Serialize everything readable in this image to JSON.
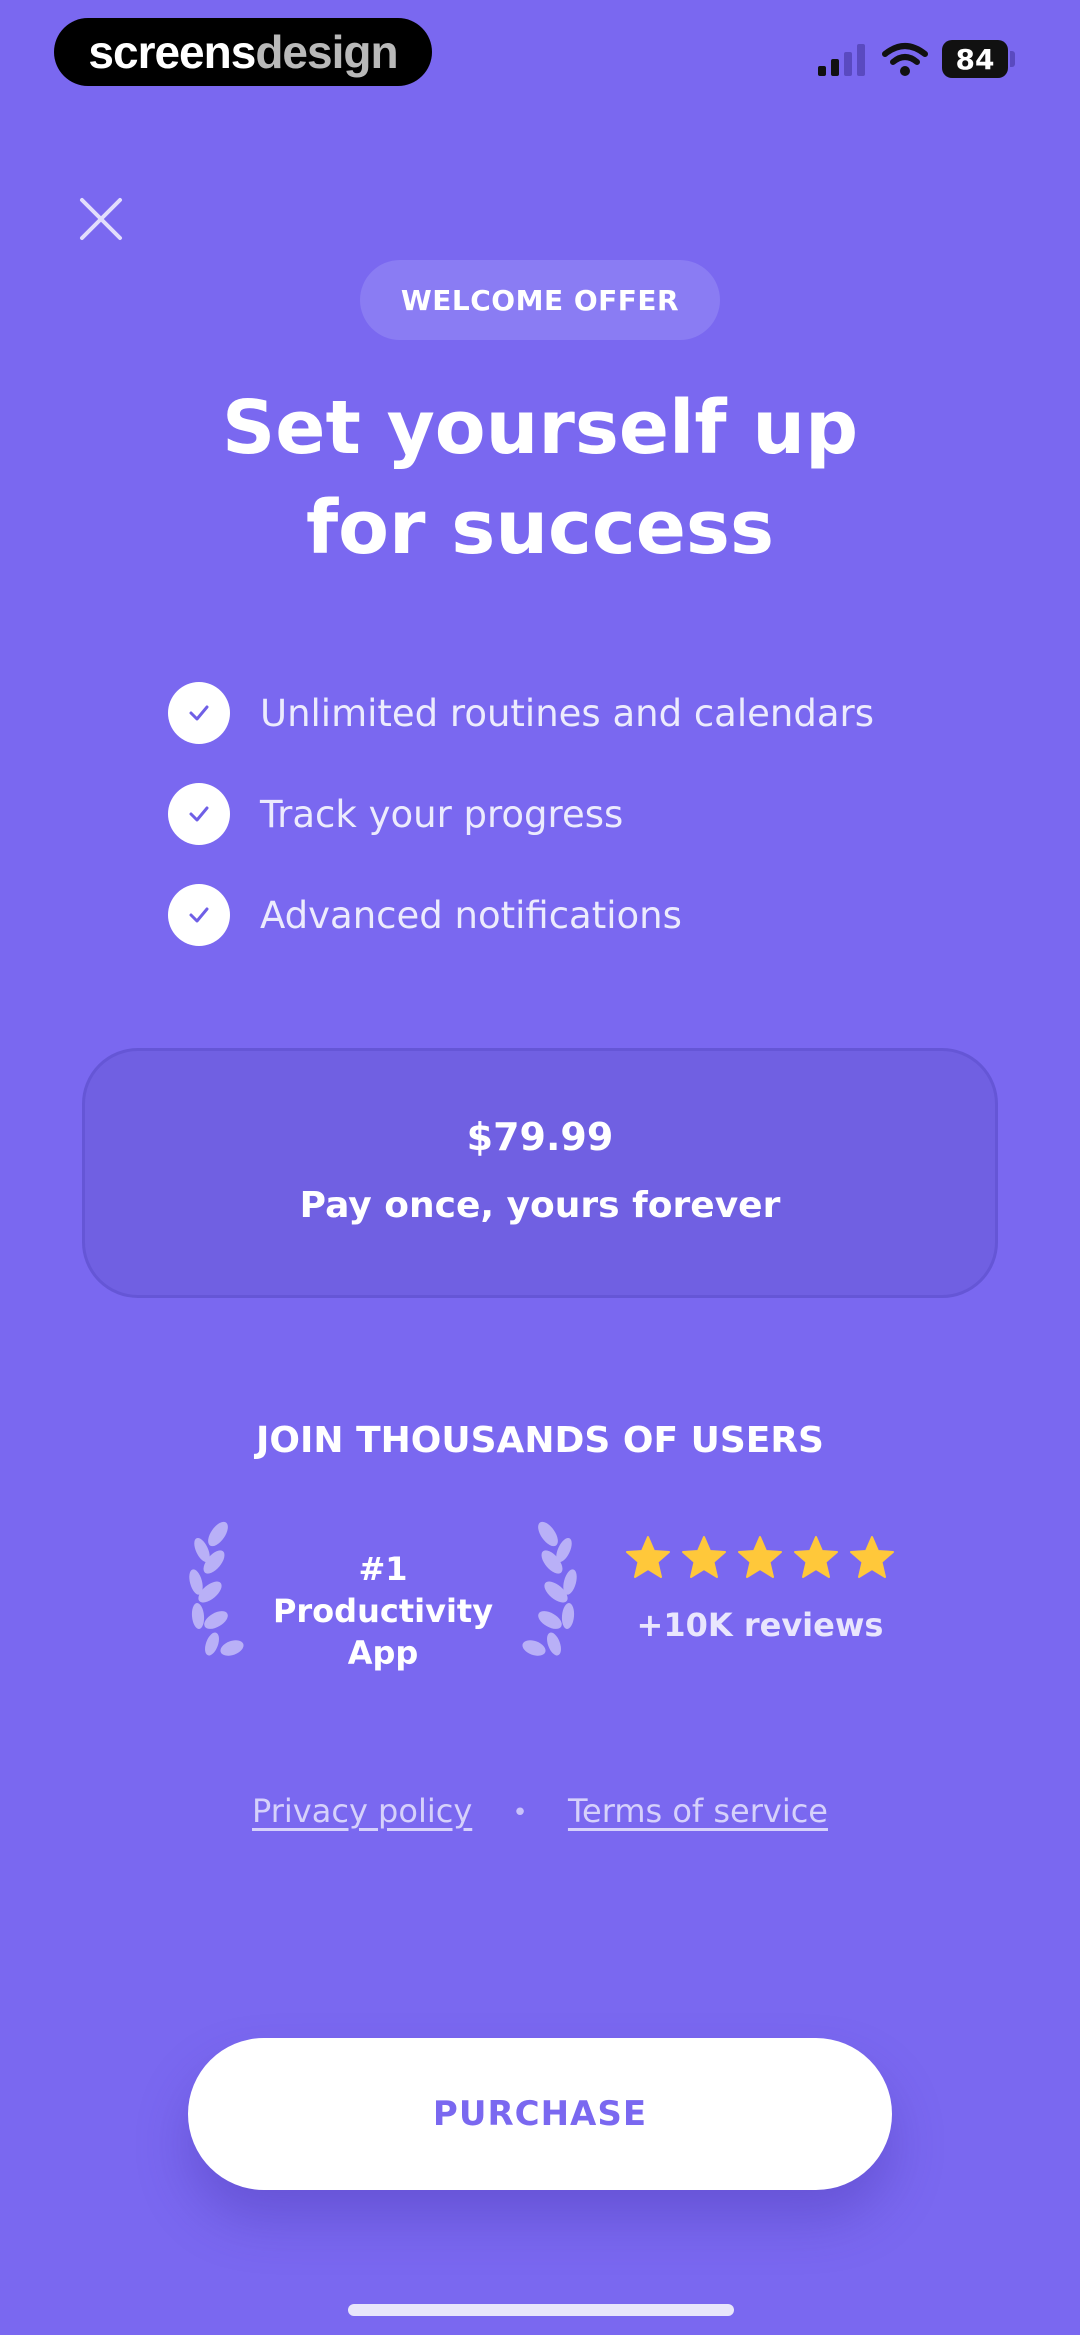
{
  "watermark": {
    "part1": "screens",
    "part2": "design"
  },
  "status_bar": {
    "battery": "84"
  },
  "offer": {
    "badge": "WELCOME OFFER"
  },
  "headline": {
    "line1": "Set yourself up",
    "line2": "for success"
  },
  "features": [
    {
      "icon": "check-icon",
      "label": "Unlimited routines and calendars"
    },
    {
      "icon": "check-icon",
      "label": "Track your progress"
    },
    {
      "icon": "check-icon",
      "label": "Advanced notifications"
    }
  ],
  "plan": {
    "price": "$79.99",
    "description": "Pay once, yours forever"
  },
  "social_proof": {
    "title": "JOIN THOUSANDS OF USERS",
    "award_line1": "#1 Productivity",
    "award_line2": "App",
    "rating_stars": 5,
    "reviews": "+10K reviews"
  },
  "links": {
    "privacy": "Privacy policy",
    "separator": "•",
    "terms": "Terms of service"
  },
  "cta": {
    "purchase": "PURCHASE"
  },
  "colors": {
    "background": "#7a68f0",
    "star": "#ffc83a",
    "accent": "#7a68f0"
  }
}
